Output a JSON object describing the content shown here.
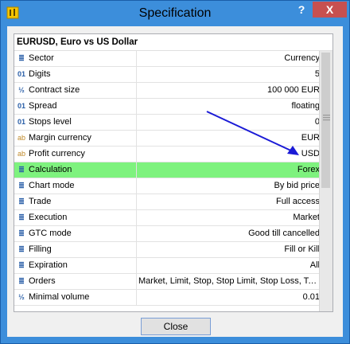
{
  "window": {
    "title": "Specification",
    "help_label": "?",
    "close_label": "X"
  },
  "list": {
    "header": "EURUSD, Euro vs US Dollar",
    "rows": [
      {
        "icon": "list-icon",
        "label": "Sector",
        "value": "Currency"
      },
      {
        "icon": "digits-icon",
        "label": "Digits",
        "value": "5"
      },
      {
        "icon": "fraction-icon",
        "label": "Contract size",
        "value": "100 000 EUR"
      },
      {
        "icon": "digits-icon",
        "label": "Spread",
        "value": "floating"
      },
      {
        "icon": "digits-icon",
        "label": "Stops level",
        "value": "0"
      },
      {
        "icon": "text-icon",
        "label": "Margin currency",
        "value": "EUR"
      },
      {
        "icon": "text-icon",
        "label": "Profit currency",
        "value": "USD"
      },
      {
        "icon": "list-icon",
        "label": "Calculation",
        "value": "Forex",
        "highlight": true
      },
      {
        "icon": "list-icon",
        "label": "Chart mode",
        "value": "By bid price"
      },
      {
        "icon": "list-icon",
        "label": "Trade",
        "value": "Full access"
      },
      {
        "icon": "list-icon",
        "label": "Execution",
        "value": "Market"
      },
      {
        "icon": "list-icon",
        "label": "GTC mode",
        "value": "Good till cancelled"
      },
      {
        "icon": "list-icon",
        "label": "Filling",
        "value": "Fill or Kill"
      },
      {
        "icon": "list-icon",
        "label": "Expiration",
        "value": "All"
      },
      {
        "icon": "list-icon",
        "label": "Orders",
        "value": "Market, Limit, Stop, Stop Limit, Stop Loss, Ta..."
      },
      {
        "icon": "fraction-icon",
        "label": "Minimal volume",
        "value": "0.01"
      }
    ]
  },
  "footer": {
    "close_button": "Close"
  },
  "colors": {
    "highlight": "#7ef27e",
    "annotation_arrow": "#1a1ad6"
  }
}
